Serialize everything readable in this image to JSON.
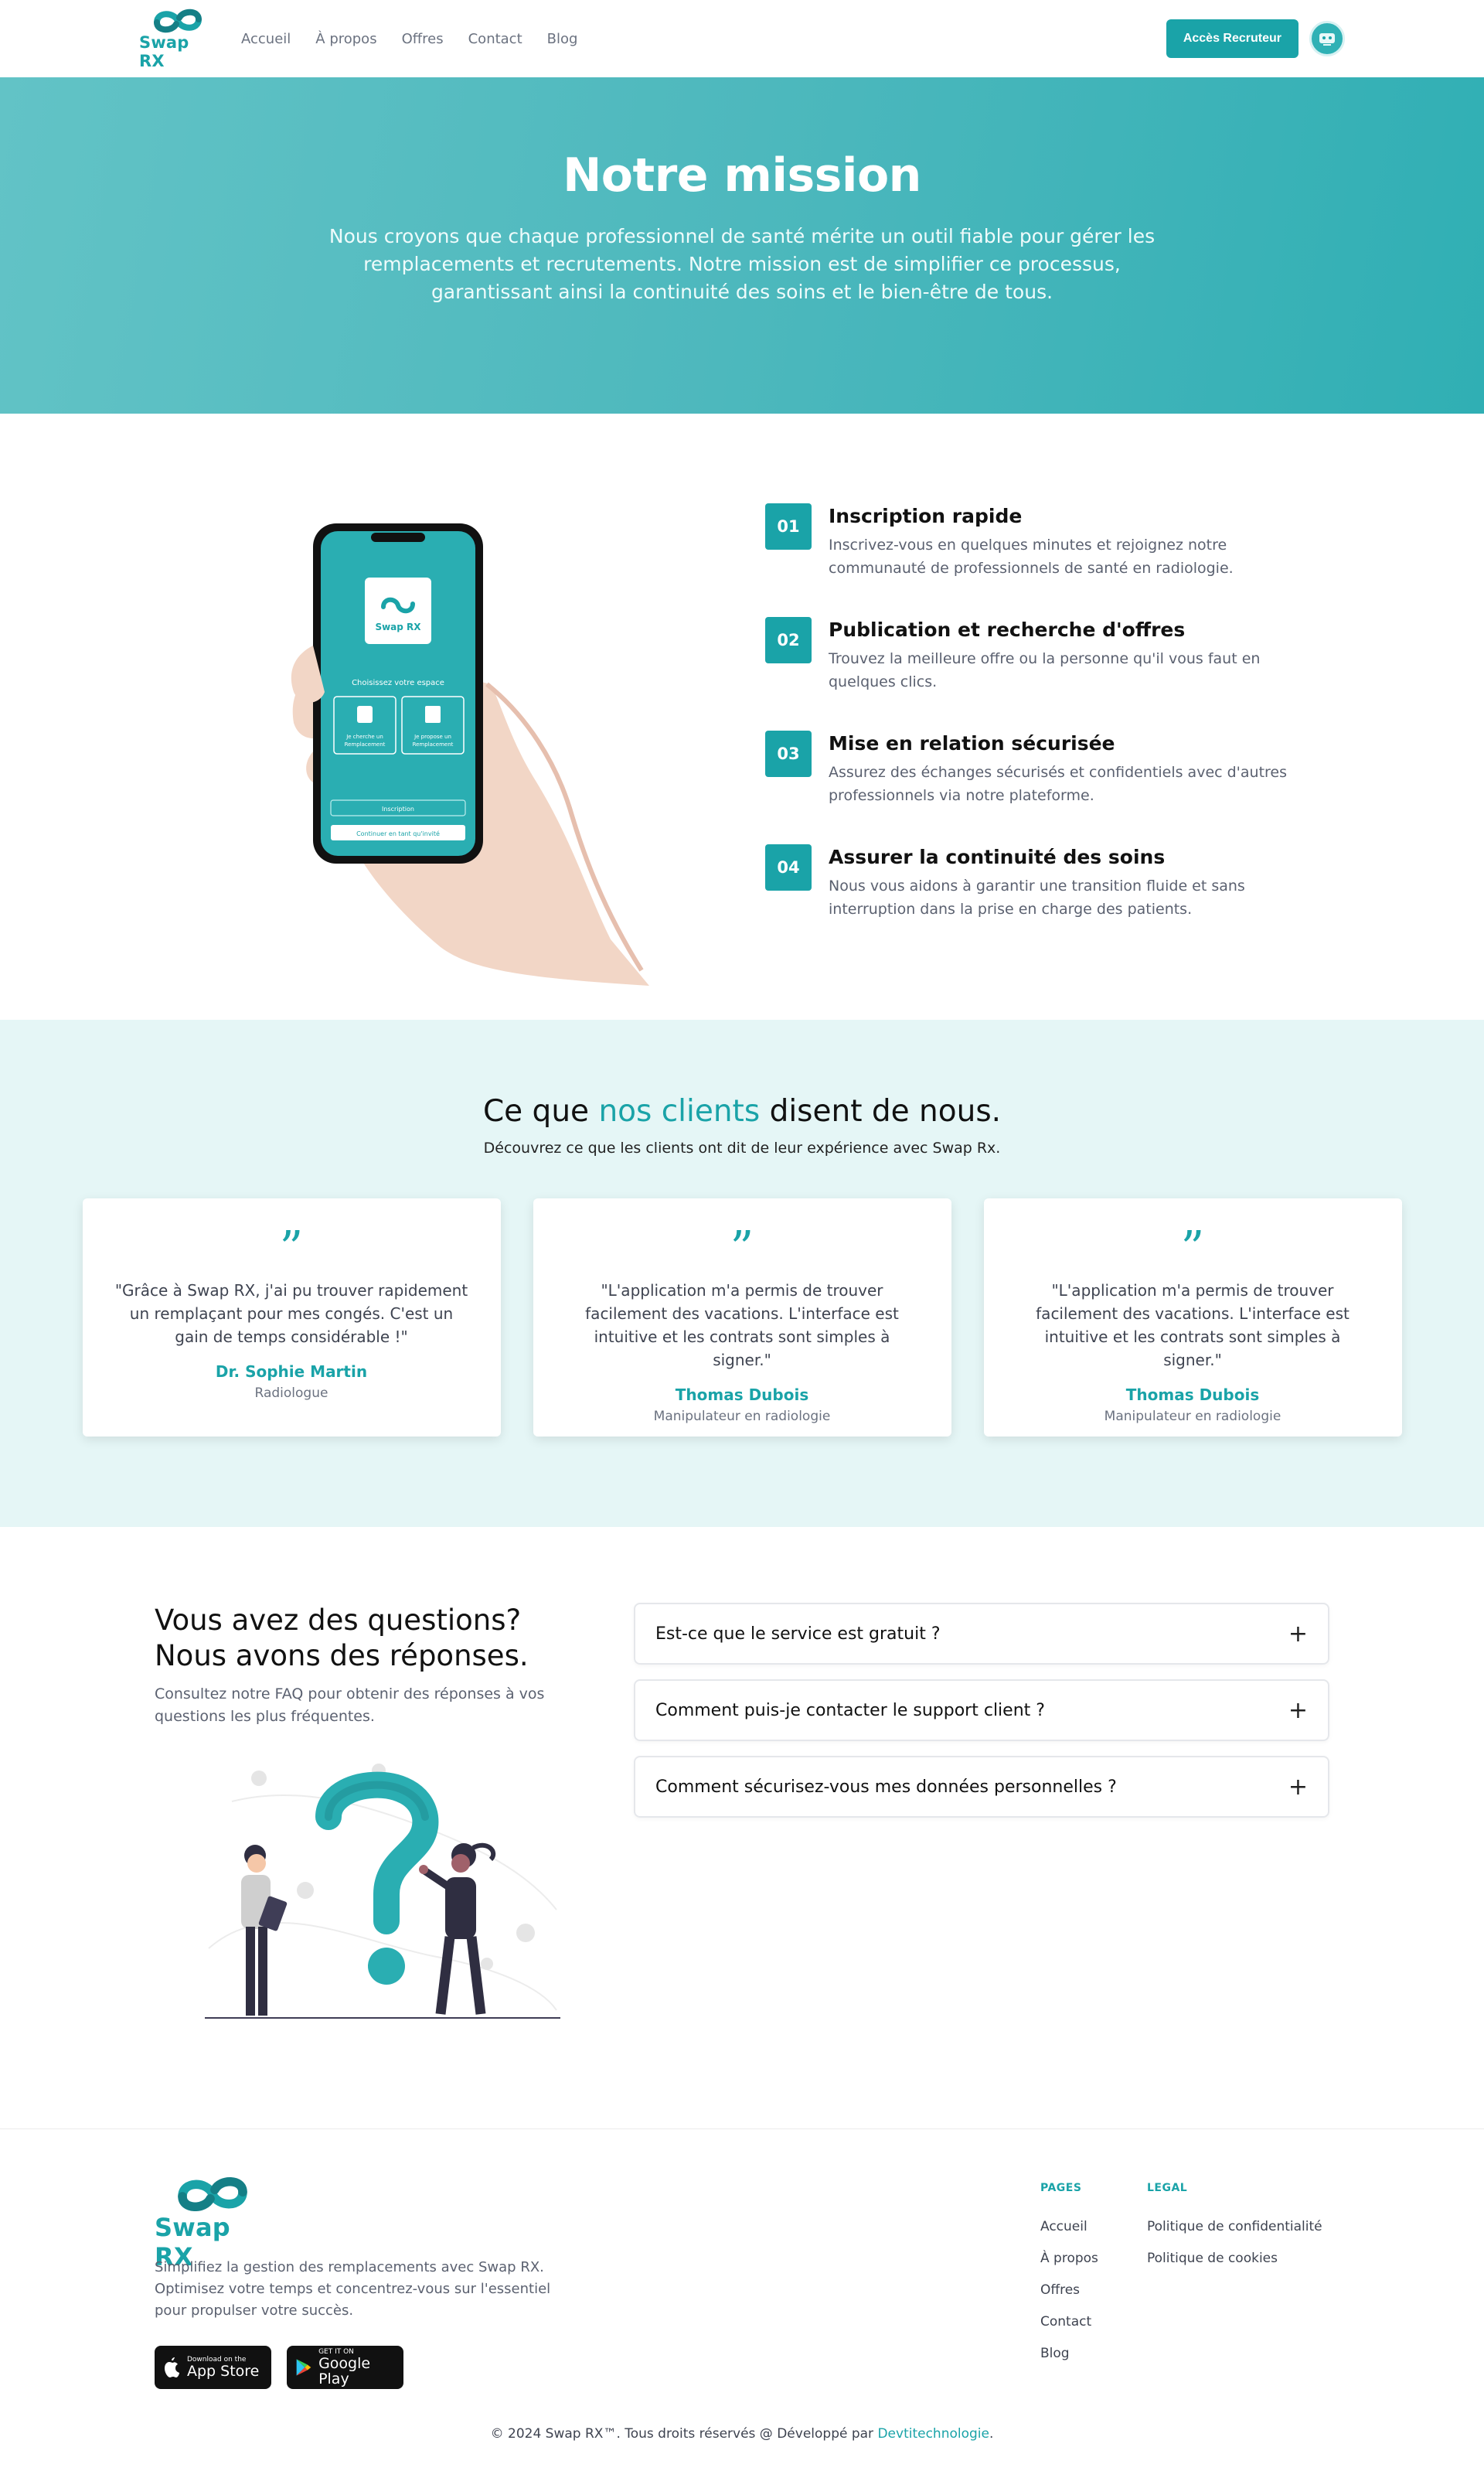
{
  "header": {
    "logo_text": "Swap RX",
    "nav": [
      "Accueil",
      "À propos",
      "Offres",
      "Contact",
      "Blog"
    ],
    "cta_label": "Accès Recruteur"
  },
  "hero": {
    "title": "Notre mission",
    "text": "Nous croyons que chaque professionnel de santé mérite un outil fiable pour gérer les remplacements et recrutements. Notre mission est de simplifier ce processus, garantissant ainsi la continuité des soins et le bien-être de tous."
  },
  "phone": {
    "logo_text": "Swap RX",
    "choose": "Choisissez votre espace",
    "option1": "Je cherche un Remplacement",
    "option2": "Je propose un Remplacement",
    "signup": "Inscription",
    "guest": "Continuer en tant qu'invité"
  },
  "steps": [
    {
      "num": "01",
      "title": "Inscription rapide",
      "desc": "Inscrivez-vous en quelques minutes et rejoignez notre communauté de professionnels de santé en radiologie."
    },
    {
      "num": "02",
      "title": "Publication et recherche d'offres",
      "desc": "Trouvez la meilleure offre ou la personne qu'il vous faut en quelques clics."
    },
    {
      "num": "03",
      "title": "Mise en relation sécurisée",
      "desc": "Assurez des échanges sécurisés et confidentiels avec d'autres professionnels via notre plateforme."
    },
    {
      "num": "04",
      "title": "Assurer la continuité des soins",
      "desc": "Nous vous aidons à garantir une transition fluide et sans interruption dans la prise en charge des patients."
    }
  ],
  "testimonials": {
    "title_before": "Ce que ",
    "title_accent": "nos clients",
    "title_after": " disent de nous.",
    "subtitle": "Découvrez ce que les clients ont dit de leur expérience avec Swap Rx.",
    "items": [
      {
        "quote": "\"Grâce à Swap RX, j'ai pu trouver rapidement un remplaçant pour mes congés. C'est un gain de temps considérable !\"",
        "name": "Dr. Sophie Martin",
        "role": "Radiologue"
      },
      {
        "quote": "\"L'application m'a permis de trouver facilement des vacations. L'interface est intuitive et les contrats sont simples à signer.\"",
        "name": "Thomas Dubois",
        "role": "Manipulateur en radiologie"
      },
      {
        "quote": "\"L'application m'a permis de trouver facilement des vacations. L'interface est intuitive et les contrats sont simples à signer.\"",
        "name": "Thomas Dubois",
        "role": "Manipulateur en radiologie"
      }
    ]
  },
  "faq": {
    "title_line1": "Vous avez des questions?",
    "title_line2": "Nous avons des réponses.",
    "subtitle": "Consultez notre FAQ pour obtenir des réponses à vos questions les plus fréquentes.",
    "questions": [
      "Est-ce que le service est gratuit ?",
      "Comment puis-je contacter le support client ?",
      "Comment sécurisez-vous mes données personnelles ?"
    ]
  },
  "footer": {
    "logo_text": "Swap RX",
    "description": "Simplifiez la gestion des remplacements avec Swap RX. Optimisez votre temps et concentrez-vous sur l'essentiel pour propulser votre succès.",
    "appstore_small": "Download on the",
    "appstore_big": "App Store",
    "googleplay_small": "GET IT ON",
    "googleplay_big": "Google Play",
    "pages_heading": "PAGES",
    "pages": [
      "Accueil",
      "À propos",
      "Offres",
      "Contact",
      "Blog"
    ],
    "legal_heading": "LEGAL",
    "legal": [
      "Politique de confidentialité",
      "Politique de cookies"
    ],
    "copyright": "© 2024 Swap RX™. Tous droits réservés @ Développé par ",
    "developer": "Devtitechnologie",
    "period": "."
  },
  "colors": {
    "accent": "#1aa3a8",
    "hero_start": "#62c3c6",
    "hero_end": "#30afb4",
    "testimonial_bg": "#e5f6f6"
  }
}
